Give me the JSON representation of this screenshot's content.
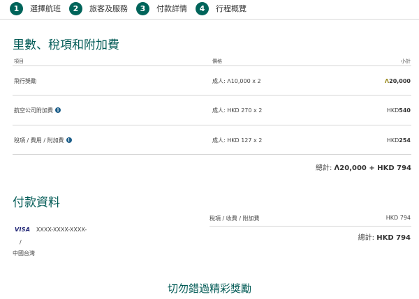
{
  "steps": [
    {
      "number": "1",
      "label": "選擇航班"
    },
    {
      "number": "2",
      "label": "旅客及服務"
    },
    {
      "number": "3",
      "label": "付款詳情"
    },
    {
      "number": "4",
      "label": "行程概覽"
    }
  ],
  "fees": {
    "title": "里數、稅項和附加費",
    "headers": {
      "item": "項目",
      "price": "價格",
      "subtotal": "小計"
    },
    "rows": [
      {
        "item": "飛行獎勵",
        "price": "成人: ᐱ10,000 x 2",
        "sub_prefix": "ᐱ",
        "sub_value": "20,000"
      },
      {
        "item": "航空公司附加費",
        "price": "成人: HKD 270 x 2",
        "sub_prefix": "HKD ",
        "sub_value": "540"
      },
      {
        "item": "稅項 / 費用 / 附加費",
        "price": "成人: HKD 127 x 2",
        "sub_prefix": "HKD ",
        "sub_value": "254"
      }
    ],
    "total_label": "總計:",
    "total_value": "ᐱ20,000 + HKD 794"
  },
  "payment": {
    "title": "付款資料",
    "card_brand": "VISA",
    "card_number": "XXXX-XXXX-XXXX-",
    "card_extra": "/",
    "country": "中國台灣",
    "tax_label": "稅項 / 收費 / 附加費",
    "tax_value": "HKD 794",
    "total_label": "總計:",
    "total_value": "HKD 794"
  },
  "promo": {
    "title": "切勿錯過精彩獎勵"
  },
  "colors": {
    "accent": "#00645a",
    "miles": "#9a8a1c",
    "info_icon": "#1d5f8a"
  }
}
